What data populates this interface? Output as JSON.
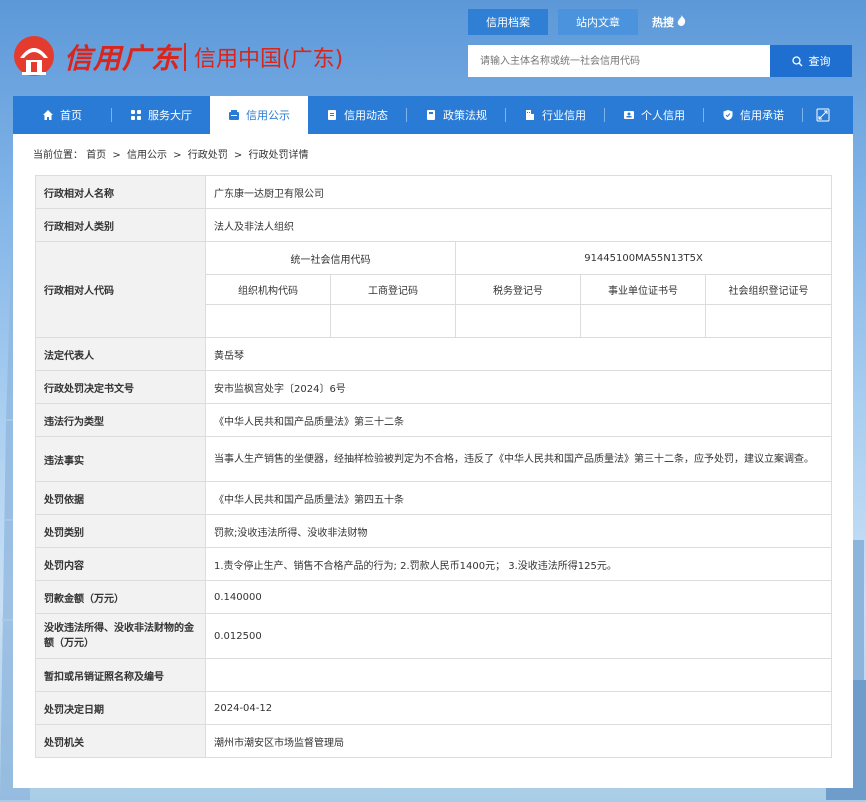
{
  "header": {
    "logo_script": "信用广东",
    "logo_main": "信用中国(广东)",
    "top_tabs": [
      "信用档案",
      "站内文章",
      "热搜"
    ],
    "search_placeholder": "请输入主体名称或统一社会信用代码",
    "search_button": "查询"
  },
  "nav": {
    "items": [
      "首页",
      "服务大厅",
      "信用公示",
      "信用动态",
      "政策法规",
      "行业信用",
      "个人信用",
      "信用承诺"
    ],
    "active": "信用公示"
  },
  "breadcrumb": {
    "prefix": "当前位置：",
    "items": [
      "首页",
      "信用公示",
      "行政处罚",
      "行政处罚详情"
    ]
  },
  "detail": {
    "name_label": "行政相对人名称",
    "name_value": "广东康一达厨卫有限公司",
    "type_label": "行政相对人类别",
    "type_value": "法人及非法人组织",
    "code_label": "行政相对人代码",
    "uscc_label": "统一社会信用代码",
    "uscc_value": "91445100MA55N13T5X",
    "sub_codes": [
      "组织机构代码",
      "工商登记码",
      "税务登记号",
      "事业单位证书号",
      "社会组织登记证号"
    ],
    "rows": [
      {
        "label": "法定代表人",
        "value": "黄岳琴"
      },
      {
        "label": "行政处罚决定书文号",
        "value": "安市监枫宫处字〔2024〕6号"
      },
      {
        "label": "违法行为类型",
        "value": "《中华人民共和国产品质量法》第三十二条"
      },
      {
        "label": "违法事实",
        "value": "当事人生产销售的坐便器，经抽样检验被判定为不合格，违反了《中华人民共和国产品质量法》第三十二条，应予处罚，建议立案调查。"
      },
      {
        "label": "处罚依据",
        "value": "《中华人民共和国产品质量法》第四五十条"
      },
      {
        "label": "处罚类别",
        "value": "罚款;没收违法所得、没收非法财物"
      },
      {
        "label": "处罚内容",
        "value": "1.责令停止生产、销售不合格产品的行为; 2.罚款人民币1400元； 3.没收违法所得125元。"
      },
      {
        "label": "罚款金额（万元）",
        "value": "0.140000"
      },
      {
        "label": "没收违法所得、没收非法财物的金额（万元）",
        "value": "0.012500"
      },
      {
        "label": "暂扣或吊销证照名称及编号",
        "value": ""
      },
      {
        "label": "处罚决定日期",
        "value": "2024-04-12"
      },
      {
        "label": "处罚机关",
        "value": "潮州市潮安区市场监督管理局"
      }
    ]
  }
}
